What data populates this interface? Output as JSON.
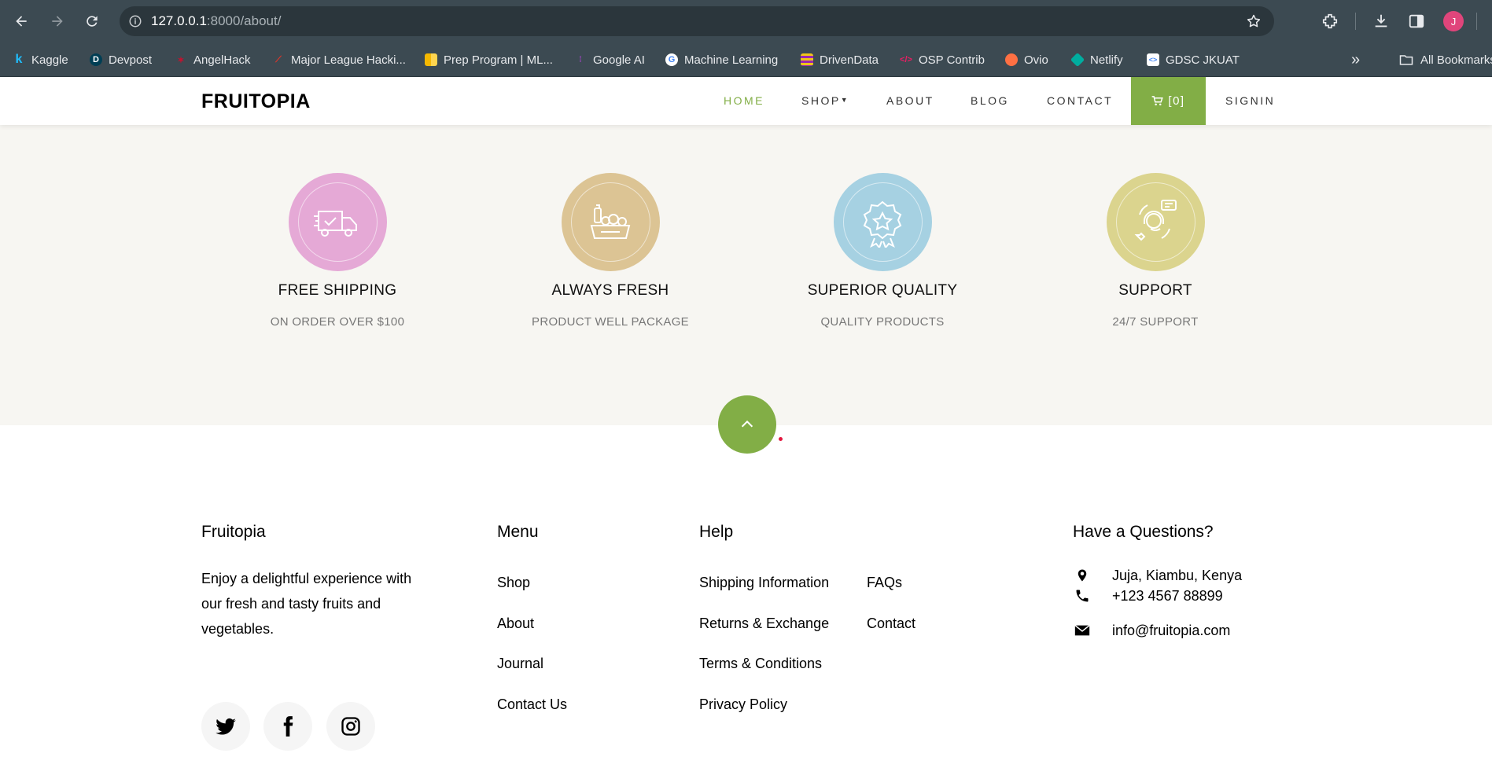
{
  "browser": {
    "url_host": "127.0.0.1",
    "url_path": ":8000/about/",
    "profile_initial": "J",
    "bookmarks": [
      {
        "label": "Kaggle",
        "icon": "kaggle-icon",
        "color": "#20beff"
      },
      {
        "label": "Devpost",
        "icon": "devpost-icon",
        "color": "#003e54"
      },
      {
        "label": "AngelHack",
        "icon": "angelhack-icon",
        "color": "#c8102e"
      },
      {
        "label": "Major League Hacki...",
        "icon": "mlh-icon",
        "color": "#e73427"
      },
      {
        "label": "Prep Program | ML...",
        "icon": "prep-icon",
        "color": "#f5b800"
      },
      {
        "label": "Google AI",
        "icon": "google-ai-icon",
        "color": "#8e44ad"
      },
      {
        "label": "Machine Learning",
        "icon": "google-icon",
        "color": "#ffffff"
      },
      {
        "label": "DrivenData",
        "icon": "drivendata-icon",
        "color": "#f0c419"
      },
      {
        "label": "OSP Contrib",
        "icon": "code-icon",
        "color": "#e91e63"
      },
      {
        "label": "Ovio",
        "icon": "ovio-icon",
        "color": "#ff7043"
      },
      {
        "label": "Netlify",
        "icon": "netlify-icon",
        "color": "#00ad9f"
      },
      {
        "label": "GDSC JKUAT",
        "icon": "gdsc-icon",
        "color": "#ffffff"
      }
    ],
    "all_bookmarks": "All Bookmarks"
  },
  "header": {
    "logo": "FRUITOPIA",
    "menu": {
      "home": "HOME",
      "shop": "SHOP",
      "about": "ABOUT",
      "blog": "BLOG",
      "contact": "CONTACT",
      "cart": "[0]",
      "signin": "SIGNIN"
    },
    "accent": "#82ae46"
  },
  "features": [
    {
      "title": "FREE SHIPPING",
      "subtitle": "ON ORDER OVER $100",
      "color": "#e5a9d6",
      "icon": "delivery-truck-icon"
    },
    {
      "title": "ALWAYS FRESH",
      "subtitle": "PRODUCT WELL PACKAGE",
      "color": "#dcc494",
      "icon": "fresh-produce-icon"
    },
    {
      "title": "SUPERIOR QUALITY",
      "subtitle": "QUALITY PRODUCTS",
      "color": "#a6d1e2",
      "icon": "quality-badge-icon"
    },
    {
      "title": "SUPPORT",
      "subtitle": "24/7 SUPPORT",
      "color": "#dbd48e",
      "icon": "customer-support-icon"
    }
  ],
  "footer": {
    "about": {
      "heading": "Fruitopia",
      "text": "Enjoy a delightful experience with our fresh and tasty fruits and vegetables."
    },
    "menu": {
      "heading": "Menu",
      "links": [
        "Shop",
        "About",
        "Journal",
        "Contact Us"
      ]
    },
    "help": {
      "heading": "Help",
      "col1": [
        "Shipping Information",
        "Returns & Exchange",
        "Terms & Conditions",
        "Privacy Policy"
      ],
      "col2": [
        "FAQs",
        "Contact"
      ]
    },
    "contact": {
      "heading": "Have a Questions?",
      "address": "Juja, Kiambu, Kenya",
      "phone": "+123 4567 88899",
      "email": "info@fruitopia.com"
    },
    "social": [
      "twitter-icon",
      "facebook-icon",
      "instagram-icon"
    ]
  }
}
